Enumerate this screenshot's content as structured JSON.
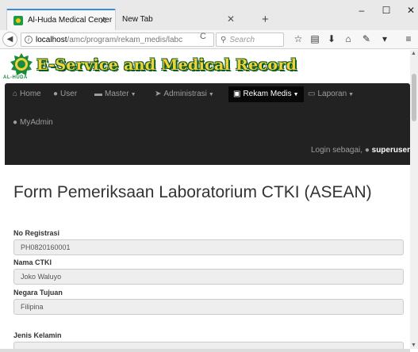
{
  "browser": {
    "active_tab_title": "Al-Huda Medical Center",
    "inactive_tab_title": "New Tab",
    "url_host": "localhost",
    "url_path": "/amc/program/rekam_medis/labc",
    "search_placeholder": "Search"
  },
  "brand": {
    "title": "E-Service and Medical Record",
    "logo_text": "AL-HUDA"
  },
  "menu": {
    "items": [
      {
        "label": "Home",
        "icon": "home-icon"
      },
      {
        "label": "User",
        "icon": "user-icon"
      },
      {
        "label": "Master",
        "icon": "list-icon",
        "dropdown": true
      },
      {
        "label": "Administrasi",
        "icon": "tags-icon",
        "dropdown": true
      },
      {
        "label": "Rekam Medis",
        "icon": "book-icon",
        "dropdown": true,
        "active": true
      },
      {
        "label": "Laporan",
        "icon": "report-icon",
        "dropdown": true
      },
      {
        "label": "MyAdmin",
        "icon": "user-icon"
      }
    ],
    "login_prefix": "Login sebagai,",
    "login_user": "superuser"
  },
  "form": {
    "title": "Form Pemeriksaan Laboratorium CTKI (ASEAN)",
    "fields": [
      {
        "label": "No Registrasi",
        "value": "PH0820160001"
      },
      {
        "label": "Nama CTKI",
        "value": "Joko Waluyo"
      },
      {
        "label": "Negara Tujuan",
        "value": "Filipina"
      },
      {
        "label": "Jenis Kelamin",
        "value": ""
      }
    ]
  },
  "colors": {
    "navbar_bg": "#222222",
    "brand_green": "#0e5a22",
    "brand_yellow": "#f0d23c",
    "tab_accent": "#3b8bdb"
  }
}
